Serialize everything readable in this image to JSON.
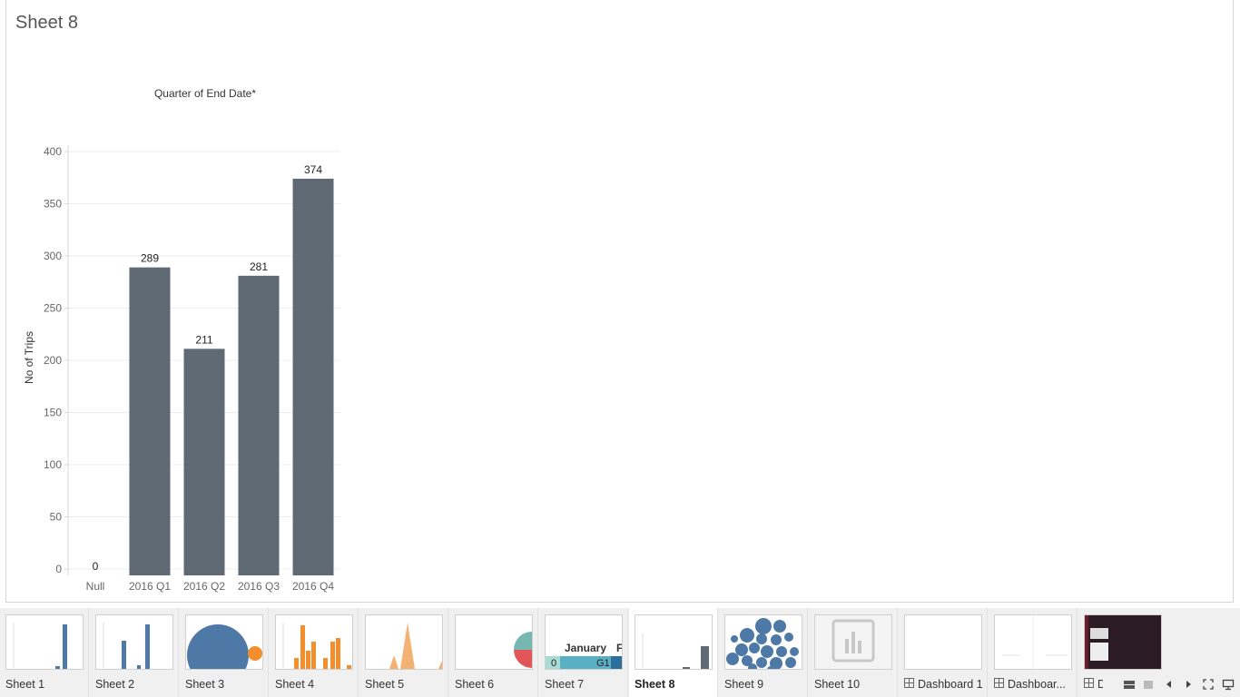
{
  "sheet": {
    "title": "Sheet 8"
  },
  "chart_data": {
    "type": "bar",
    "title": "Quarter of End Date*",
    "ylabel": "No of Trips",
    "xlabel": "",
    "categories": [
      "Null",
      "2016 Q1",
      "2016 Q2",
      "2016 Q3",
      "2016 Q4"
    ],
    "values": [
      0,
      289,
      211,
      281,
      374
    ],
    "data_labels": [
      "0",
      "289",
      "211",
      "281",
      "374"
    ],
    "ylim": [
      0,
      400
    ],
    "yticks": [
      0,
      50,
      100,
      150,
      200,
      250,
      300,
      350,
      400
    ],
    "ytick_labels": [
      "0",
      "50",
      "100",
      "150",
      "200",
      "250",
      "300",
      "350",
      "400"
    ],
    "bar_color": "#5f6a74",
    "grid": true
  },
  "tabs": [
    {
      "label": "Sheet 1",
      "type": "sheet",
      "thumb": "bars-blue",
      "active": false
    },
    {
      "label": "Sheet 2",
      "type": "sheet",
      "thumb": "bars-blue-2",
      "active": false
    },
    {
      "label": "Sheet 3",
      "type": "sheet",
      "thumb": "circles",
      "active": false
    },
    {
      "label": "Sheet 4",
      "type": "sheet",
      "thumb": "bars-orange",
      "active": false
    },
    {
      "label": "Sheet 5",
      "type": "sheet",
      "thumb": "area-peaks",
      "active": false
    },
    {
      "label": "Sheet 6",
      "type": "sheet",
      "thumb": "pie",
      "active": false
    },
    {
      "label": "Sheet 7",
      "type": "sheet",
      "thumb": "highlight-table",
      "active": false,
      "thumb_text": [
        "January",
        "F",
        "0",
        "G1"
      ]
    },
    {
      "label": "Sheet 8",
      "type": "sheet",
      "thumb": "bars-gray",
      "active": true
    },
    {
      "label": "Sheet 9",
      "type": "sheet",
      "thumb": "bubbles",
      "active": false
    },
    {
      "label": "Sheet 10",
      "type": "sheet",
      "thumb": "empty-chart-icon",
      "active": false
    },
    {
      "label": "Dashboard 1",
      "type": "dashboard",
      "thumb": "blank",
      "active": false
    },
    {
      "label": "Dashboar...",
      "type": "dashboard",
      "thumb": "blank-split",
      "active": false
    },
    {
      "label": "D",
      "type": "dashboard",
      "thumb": "dark",
      "active": false
    }
  ],
  "controls": [
    {
      "name": "show-filmstrip-button",
      "icon": "filmstrip-icon"
    },
    {
      "name": "show-tabs-button",
      "icon": "tabs-icon"
    },
    {
      "name": "previous-sheet-button",
      "icon": "arrow-left-icon"
    },
    {
      "name": "next-sheet-button",
      "icon": "arrow-right-icon"
    },
    {
      "name": "fullscreen-button",
      "icon": "fullscreen-icon"
    },
    {
      "name": "presentation-mode-button",
      "icon": "presentation-icon"
    }
  ]
}
